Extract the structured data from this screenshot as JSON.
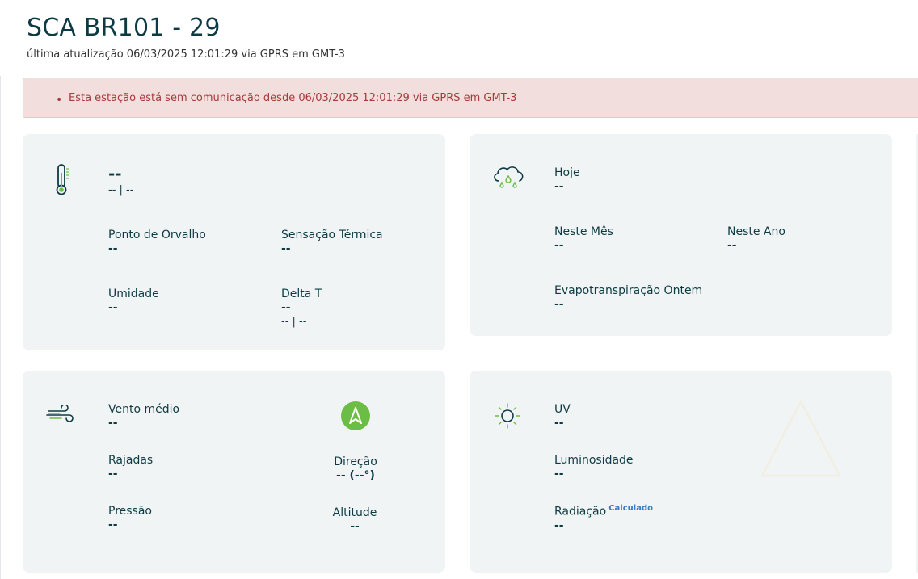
{
  "header": {
    "title": "SCA BR101 - 29",
    "last_update": "última atualização 06/03/2025 12:01:29 via GPRS em GMT-3"
  },
  "alert": {
    "message": "Esta estação está sem comunicação desde 06/03/2025 12:01:29 via GPRS em GMT-3",
    "color": "#a73a3a"
  },
  "temperature_card": {
    "icon": "thermometer-icon",
    "current": "--",
    "min_max": "-- | --",
    "dew_point_label": "Ponto de Orvalho",
    "dew_point_value": "--",
    "feels_like_label": "Sensação Térmica",
    "feels_like_value": "--",
    "humidity_label": "Umidade",
    "humidity_value": "--",
    "delta_t_label": "Delta T",
    "delta_t_value": "--",
    "delta_t_range": "-- | --"
  },
  "rain_card": {
    "icon": "rain-cloud-icon",
    "today_label": "Hoje",
    "today_value": "--",
    "month_label": "Neste Mês",
    "month_value": "--",
    "year_label": "Neste Ano",
    "year_value": "--",
    "evapo_label": "Evapotranspiração Ontem",
    "evapo_value": "--"
  },
  "wind_card": {
    "icon": "wind-icon",
    "avg_label": "Vento médio",
    "avg_value": "--",
    "gusts_label": "Rajadas",
    "gusts_value": "--",
    "pressure_label": "Pressão",
    "pressure_value": "--",
    "direction_label": "Direção",
    "direction_value": "-- (--°)",
    "altitude_label": "Altitude",
    "altitude_value": "--",
    "compass_color": "#6cbd45"
  },
  "sun_card": {
    "icon": "sun-icon",
    "uv_label": "UV",
    "uv_value": "--",
    "lum_label": "Luminosidade",
    "lum_value": "--",
    "rad_label": "Radiação",
    "rad_badge": "Calculado",
    "rad_value": "--"
  },
  "colors": {
    "accent_green": "#6cbd45",
    "text_dark": "#0e3b43",
    "card_bg": "#f0f4f5"
  }
}
